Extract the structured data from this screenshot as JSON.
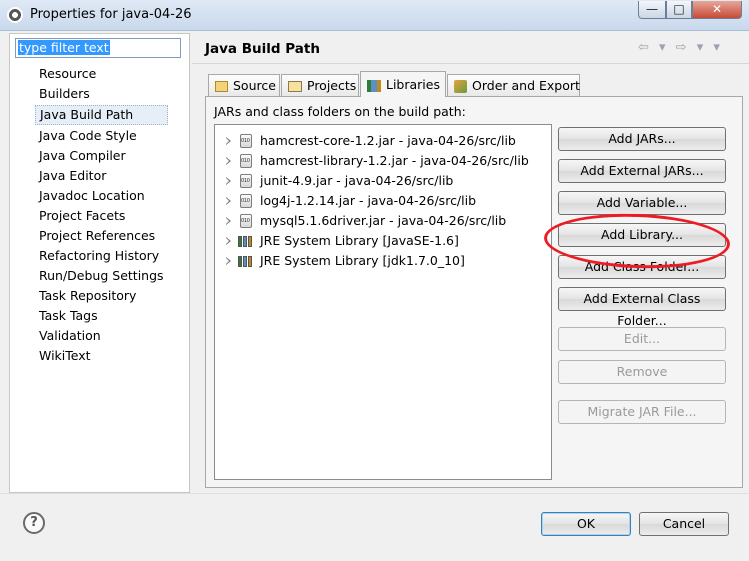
{
  "window": {
    "title": "Properties for java-04-26",
    "controls": {
      "minimize": "—",
      "maximize": "□",
      "close": "✕"
    }
  },
  "filter": {
    "value": "type filter text"
  },
  "nav": {
    "items": [
      "Resource",
      "Builders",
      "Java Build Path",
      "Java Code Style",
      "Java Compiler",
      "Java Editor",
      "Javadoc Location",
      "Project Facets",
      "Project References",
      "Refactoring History",
      "Run/Debug Settings",
      "Task Repository",
      "Task Tags",
      "Validation",
      "WikiText"
    ],
    "selected": "Java Build Path"
  },
  "page": {
    "title": "Java Build Path",
    "nav_arrows": "⇦ ▾ ⇨ ▾ ▾"
  },
  "tabs": {
    "source": "Source",
    "projects": "Projects",
    "libraries": "Libraries",
    "order": "Order and Export",
    "active": "Libraries"
  },
  "libraries": {
    "section_label": "JARs and class folders on the build path:",
    "entries": [
      {
        "label": "hamcrest-core-1.2.jar - java-04-26/src/lib",
        "icon": "jar-icon"
      },
      {
        "label": "hamcrest-library-1.2.jar - java-04-26/src/lib",
        "icon": "jar-icon"
      },
      {
        "label": "junit-4.9.jar - java-04-26/src/lib",
        "icon": "jar-icon"
      },
      {
        "label": "log4j-1.2.14.jar - java-04-26/src/lib",
        "icon": "jar-icon"
      },
      {
        "label": "mysql5.1.6driver.jar - java-04-26/src/lib",
        "icon": "jar-icon"
      },
      {
        "label": "JRE System Library [JavaSE-1.6]",
        "icon": "library-icon"
      },
      {
        "label": "JRE System Library [jdk1.7.0_10]",
        "icon": "library-icon"
      }
    ]
  },
  "buttons": {
    "add_jars": "Add JARs...",
    "add_external_jars": "Add External JARs...",
    "add_variable": "Add Variable...",
    "add_library": "Add Library...",
    "add_class_folder": "Add Class Folder...",
    "add_external_class_folder": "Add External Class Folder...",
    "edit": "Edit...",
    "remove": "Remove",
    "migrate_jar": "Migrate JAR File..."
  },
  "footer": {
    "help": "?",
    "ok": "OK",
    "cancel": "Cancel"
  },
  "colors": {
    "annotation": "#ee1b24",
    "selection": "#3399ff"
  }
}
